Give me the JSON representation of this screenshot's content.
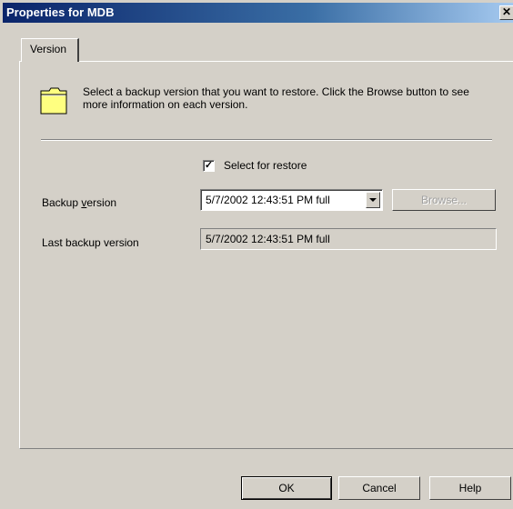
{
  "window": {
    "title": "Properties for MDB",
    "close_glyph": "✕"
  },
  "tabs": [
    {
      "label": "Version",
      "selected": true
    }
  ],
  "info": {
    "icon": "folder-icon",
    "text": "Select a backup version that you want to restore. Click the Browse button to see more information on each version."
  },
  "select_for_restore": {
    "label": "Select for restore",
    "checked": true,
    "check_glyph": "✓"
  },
  "backup_version": {
    "label_before": "Backup ",
    "label_accel": "v",
    "label_after": "ersion",
    "selected_value": "5/7/2002 12:43:51 PM full",
    "browse_label": "Browse..."
  },
  "last_backup_version": {
    "label": "Last backup version",
    "value": "5/7/2002 12:43:51 PM full"
  },
  "buttons": {
    "ok": "OK",
    "cancel": "Cancel",
    "help": "Help"
  },
  "colors": {
    "title_start": "#0a246a",
    "title_end": "#a6caf0",
    "face": "#d4d0c8",
    "folder": "#ffff80"
  }
}
